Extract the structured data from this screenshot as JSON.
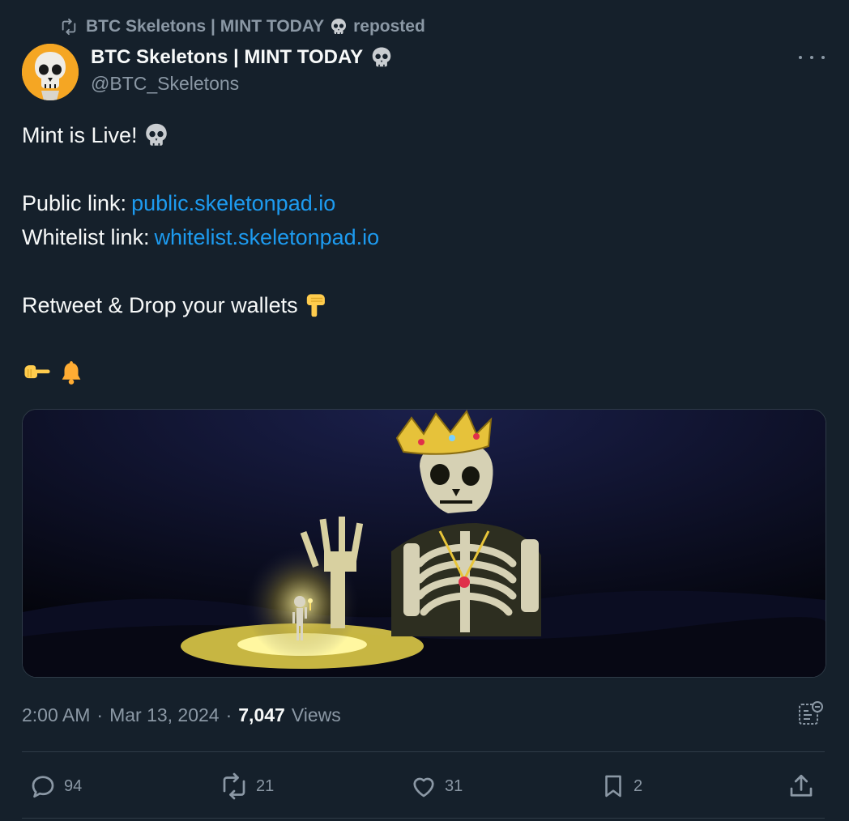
{
  "repost": {
    "account": "BTC Skeletons | MINT TODAY",
    "label": "reposted"
  },
  "author": {
    "name": "BTC Skeletons | MINT TODAY",
    "handle": "@BTC_Skeletons"
  },
  "tweet": {
    "line1": "Mint is Live!",
    "public_label": "Public link:",
    "public_url": "public.skeletonpad.io",
    "whitelist_label": "Whitelist link:",
    "whitelist_url": "whitelist.skeletonpad.io",
    "cta": "Retweet & Drop your wallets"
  },
  "meta": {
    "time": "2:00 AM",
    "sep1": "·",
    "date": "Mar 13, 2024",
    "sep2": "·",
    "views_count": "7,047",
    "views_label": "Views"
  },
  "actions": {
    "replies": "94",
    "reposts": "21",
    "likes": "31",
    "bookmarks": "2"
  },
  "colors": {
    "background": "#15202b",
    "text": "#f7f9f9",
    "muted": "#8b98a5",
    "link": "#1d9bf0",
    "avatar_bg": "#f5a623"
  },
  "icons": [
    "repost-icon",
    "skull-emoji",
    "more-icon",
    "point-down-emoji",
    "point-right-emoji",
    "bell-emoji",
    "analytics-icon",
    "reply-icon",
    "retweet-icon",
    "like-icon",
    "bookmark-icon",
    "share-icon"
  ]
}
